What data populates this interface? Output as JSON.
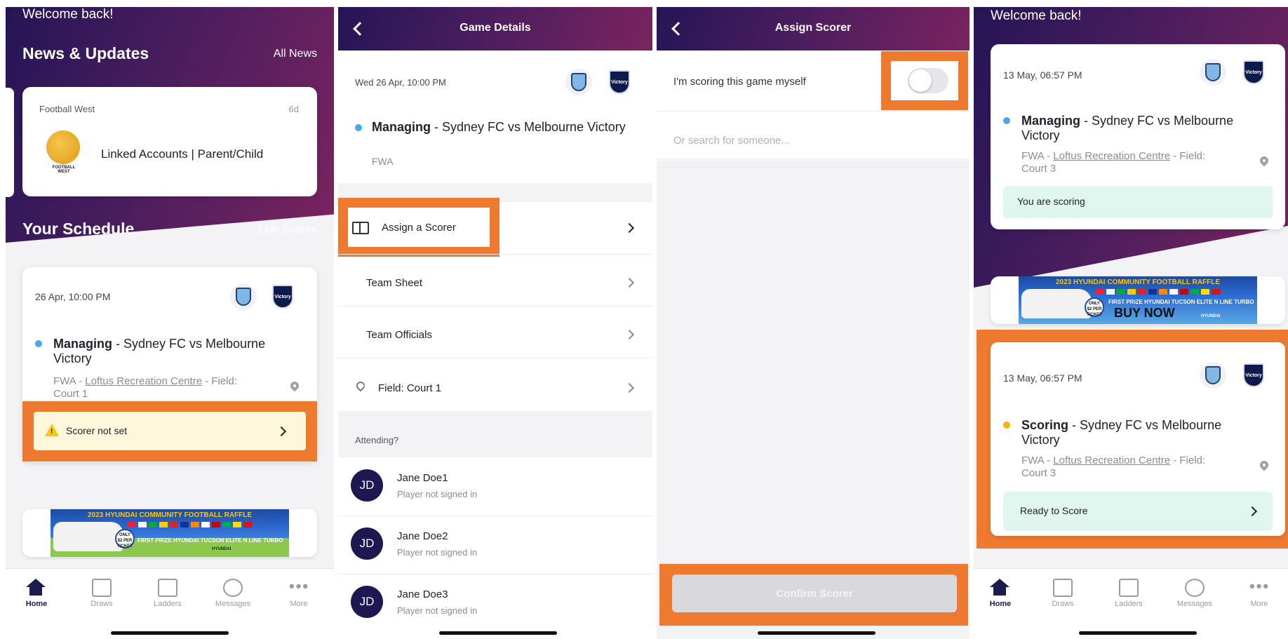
{
  "panel1": {
    "welcome": "Welcome back!",
    "news_title": "News & Updates",
    "all_news": "All News",
    "news_card": {
      "source": "Football West",
      "age": "6d",
      "logo_text": "FOOTBALL WEST",
      "headline": "Linked Accounts | Parent/Child"
    },
    "schedule_title": "Your Schedule",
    "live_scores": "Live Scores",
    "game": {
      "datetime": "26 Apr, 10:00 PM",
      "role": "Managing",
      "title_rest": " - Sydney FC vs Melbourne Victory",
      "org": "FWA - ",
      "venue": "Loftus Recreation Centre",
      "field": " - Field: Court 1",
      "status": "Scorer not set"
    }
  },
  "panel2": {
    "header": "Game Details",
    "datetime": "Wed 26 Apr, 10:00 PM",
    "role": "Managing",
    "title_rest": " - Sydney FC vs Melbourne Victory",
    "org": "FWA",
    "menu": [
      {
        "label": "Assign a Scorer"
      },
      {
        "label": "Team Sheet"
      },
      {
        "label": "Team Officials"
      },
      {
        "label": "Field: Court 1"
      }
    ],
    "attending_label": "Attending?",
    "players": [
      {
        "initials": "JD",
        "name": "Jane Doe1",
        "status": "Player not signed in"
      },
      {
        "initials": "JD",
        "name": "Jane Doe2",
        "status": "Player not signed in"
      },
      {
        "initials": "JD",
        "name": "Jane Doe3",
        "status": "Player not signed in"
      }
    ]
  },
  "panel3": {
    "header": "Assign Scorer",
    "toggle_label": "I'm scoring this game myself",
    "toggle_on": false,
    "search_placeholder": "Or search for someone...",
    "confirm": "Confirm Scorer"
  },
  "panel4": {
    "welcome": "Welcome back!",
    "game1": {
      "datetime": "13 May, 06:57 PM",
      "role": "Managing",
      "title_rest": " - Sydney FC vs Melbourne Victory",
      "org": "FWA - ",
      "venue": "Loftus Recreation Centre",
      "field": " - Field: Court 3",
      "status": "You are scoring"
    },
    "game2": {
      "datetime": "13 May, 06:57 PM",
      "role": "Scoring",
      "title_rest": " - Sydney FC vs Melbourne Victory",
      "org": "FWA - ",
      "venue": "Loftus Recreation Centre",
      "field": " - Field: Court 3",
      "status": "Ready to Score"
    }
  },
  "ad": {
    "title_a": "2023 HYUNDAI ",
    "title_b": "COMMUNITY FOOTBALL RAFFLE",
    "prize": "FIRST PRIZE HYUNDAI TUCSON ELITE N LINE TURBO",
    "price": "ONLY $2 PER TICKET",
    "buy": "BUY NOW",
    "sponsor": "HYUNDAI"
  },
  "team_badges": {
    "home": "Sydney FC",
    "away": "Victory"
  },
  "tabs": [
    "Home",
    "Draws",
    "Ladders",
    "Messages",
    "More"
  ],
  "colors": {
    "accent_orange": "#ee7a30",
    "navy": "#1b1b4e",
    "managing_dot": "#4aa8f0",
    "scoring_dot": "#f5b400",
    "warning_bg": "#fdf8dc",
    "success_bg": "#dff7ef"
  }
}
